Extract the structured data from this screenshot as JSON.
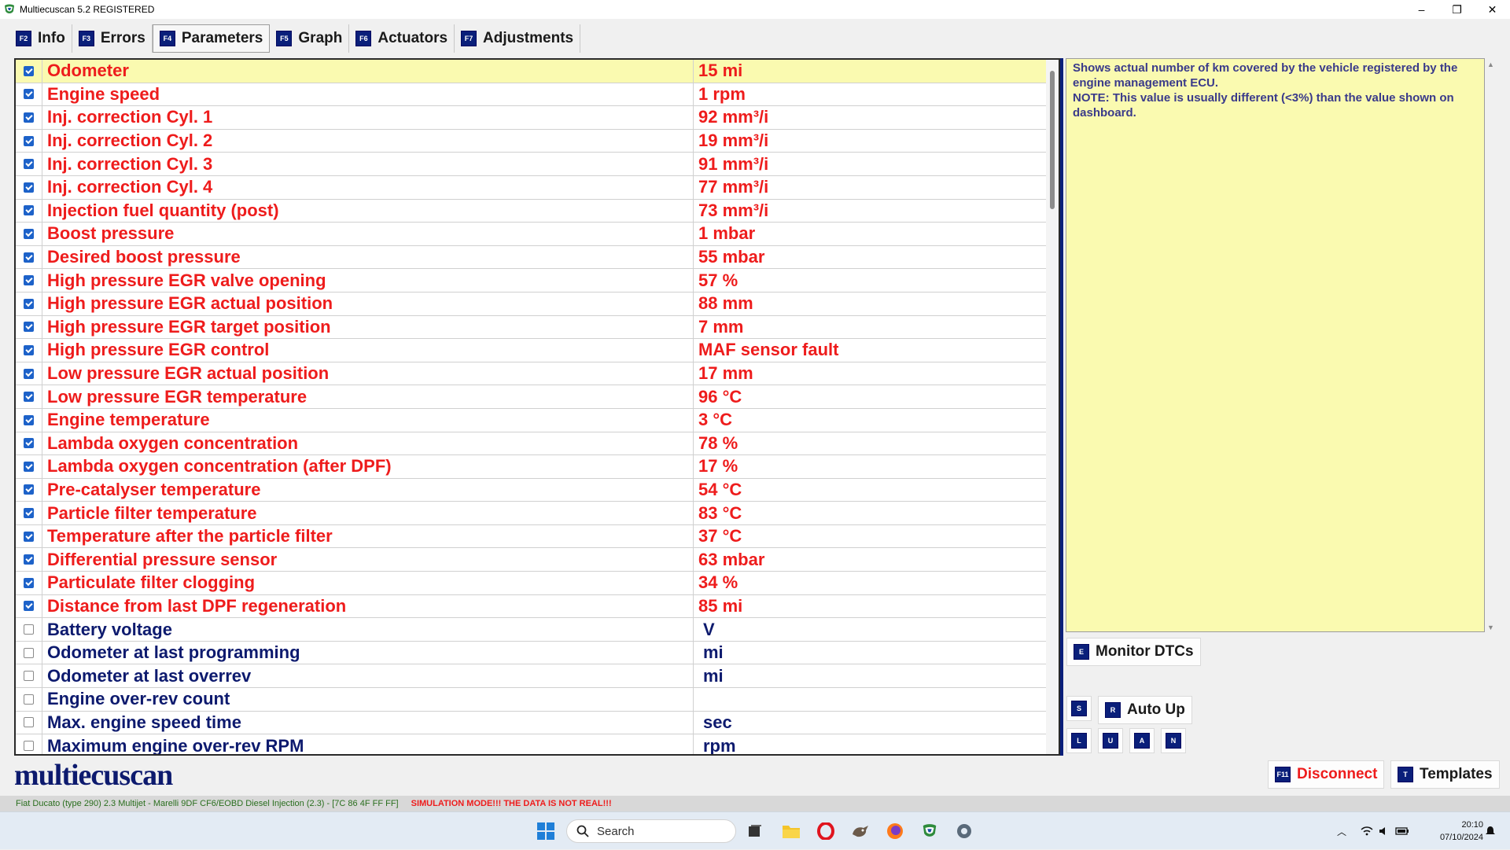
{
  "window": {
    "title": "Multiecuscan 5.2 REGISTERED",
    "controls": [
      "–",
      "❐",
      "✕"
    ]
  },
  "tabs": [
    {
      "key": "F2",
      "label": "Info",
      "active": false
    },
    {
      "key": "F3",
      "label": "Errors",
      "active": false
    },
    {
      "key": "F4",
      "label": "Parameters",
      "active": true
    },
    {
      "key": "F5",
      "label": "Graph",
      "active": false
    },
    {
      "key": "F6",
      "label": "Actuators",
      "active": false
    },
    {
      "key": "F7",
      "label": "Adjustments",
      "active": false
    }
  ],
  "parameters": [
    {
      "name": "Odometer",
      "value": "15 mi",
      "checked": true,
      "selected": true
    },
    {
      "name": "Engine speed",
      "value": "1 rpm",
      "checked": true
    },
    {
      "name": "Inj. correction Cyl. 1",
      "value": "92 mm³/i",
      "checked": true
    },
    {
      "name": "Inj. correction Cyl. 2",
      "value": "19 mm³/i",
      "checked": true
    },
    {
      "name": "Inj. correction Cyl. 3",
      "value": "91 mm³/i",
      "checked": true
    },
    {
      "name": "Inj. correction Cyl. 4",
      "value": "77 mm³/i",
      "checked": true
    },
    {
      "name": "Injection fuel quantity (post)",
      "value": "73 mm³/i",
      "checked": true
    },
    {
      "name": "Boost pressure",
      "value": "1 mbar",
      "checked": true
    },
    {
      "name": "Desired boost pressure",
      "value": "55 mbar",
      "checked": true
    },
    {
      "name": "High pressure EGR valve opening",
      "value": "57 %",
      "checked": true
    },
    {
      "name": "High pressure EGR actual position",
      "value": "88 mm",
      "checked": true
    },
    {
      "name": "High pressure EGR target position",
      "value": "7 mm",
      "checked": true
    },
    {
      "name": "High pressure EGR control",
      "value": "MAF sensor fault",
      "checked": true
    },
    {
      "name": "Low pressure EGR actual position",
      "value": "17 mm",
      "checked": true
    },
    {
      "name": "Low pressure EGR temperature",
      "value": "96 °C",
      "checked": true
    },
    {
      "name": "Engine temperature",
      "value": "3 °C",
      "checked": true
    },
    {
      "name": "Lambda oxygen concentration",
      "value": "78 %",
      "checked": true
    },
    {
      "name": "Lambda oxygen concentration (after DPF)",
      "value": "17 %",
      "checked": true
    },
    {
      "name": "Pre-catalyser temperature",
      "value": "54 °C",
      "checked": true
    },
    {
      "name": "Particle filter temperature",
      "value": "83 °C",
      "checked": true
    },
    {
      "name": "Temperature after the particle filter",
      "value": "37 °C",
      "checked": true
    },
    {
      "name": "Differential pressure sensor",
      "value": "63 mbar",
      "checked": true
    },
    {
      "name": "Particulate filter clogging",
      "value": "34 %",
      "checked": true
    },
    {
      "name": "Distance from last DPF regeneration",
      "value": "85 mi",
      "checked": true
    },
    {
      "name": "Battery voltage",
      "value": "V",
      "checked": false
    },
    {
      "name": "Odometer at last programming",
      "value": "mi",
      "checked": false
    },
    {
      "name": "Odometer at last overrev",
      "value": "mi",
      "checked": false
    },
    {
      "name": "Engine over-rev count",
      "value": "",
      "checked": false
    },
    {
      "name": "Max. engine speed time",
      "value": "sec",
      "checked": false
    },
    {
      "name": "Maximum engine over-rev RPM",
      "value": "rpm",
      "checked": false
    }
  ],
  "description": {
    "line1": "Shows actual number of km covered by the vehicle registered by the engine management ECU.",
    "line2": "NOTE: This value is usually different (<3%) than the value shown on dashboard."
  },
  "buttons": {
    "monitor_dtcs": {
      "key": "E",
      "label": "Monitor DTCs"
    },
    "s": {
      "key": "S"
    },
    "auto_up": {
      "key": "R",
      "label": "Auto Up"
    },
    "l": {
      "key": "L"
    },
    "u": {
      "key": "U"
    },
    "a": {
      "key": "A"
    },
    "n": {
      "key": "N"
    },
    "disconnect": {
      "key": "F11",
      "label": "Disconnect"
    },
    "templates": {
      "key": "T",
      "label": "Templates"
    }
  },
  "logo": "multiecuscan",
  "status": {
    "vehicle": "Fiat Ducato (type 290) 2.3 Multijet - Marelli 9DF CF6/EOBD Diesel Injection (2.3) - [7C 86 4F FF FF]",
    "simulation": "SIMULATION MODE!!! THE DATA IS NOT REAL!!!"
  },
  "taskbar": {
    "search_placeholder": "Search",
    "time": "20:10",
    "date": "07/10/2024"
  },
  "colors": {
    "active_param": "#ee1c1c",
    "inactive_param": "#0d1a6e",
    "selected_row": "#fafab0",
    "fkey_badge": "#0a1f7a"
  }
}
